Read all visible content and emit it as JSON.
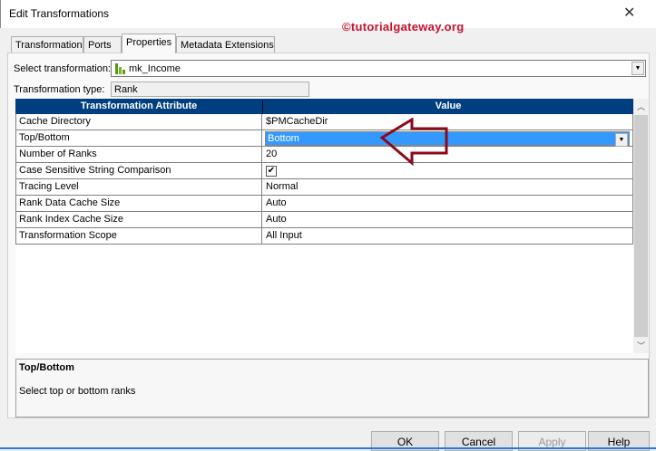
{
  "window": {
    "title": "Edit Transformations",
    "close": "✕"
  },
  "watermark": "©tutorialgateway.org",
  "tabs": [
    "Transformation",
    "Ports",
    "Properties",
    "Metadata Extensions"
  ],
  "select_label": "Select transformation:",
  "select_value": "mk_Income",
  "type_label": "Transformation type:",
  "type_value": "Rank",
  "table": {
    "headers": [
      "Transformation Attribute",
      "Value"
    ],
    "rows": [
      [
        "Cache Directory",
        "$PMCacheDir"
      ],
      [
        "Top/Bottom",
        "Bottom"
      ],
      [
        "Number of Ranks",
        "20"
      ],
      [
        "Case Sensitive String Comparison",
        "✔"
      ],
      [
        "Tracing Level",
        "Normal"
      ],
      [
        "Rank Data Cache Size",
        "Auto"
      ],
      [
        "Rank Index Cache Size",
        "Auto"
      ],
      [
        "Transformation Scope",
        "All Input"
      ]
    ]
  },
  "description": {
    "title": "Top/Bottom",
    "text": "Select top or bottom ranks"
  },
  "buttons": {
    "ok": "OK",
    "cancel": "Cancel",
    "apply": "Apply",
    "help": "Help"
  },
  "colors": {
    "header": "#003f7f",
    "selection": "#3399ff",
    "arrow": "#8b0a1a"
  }
}
